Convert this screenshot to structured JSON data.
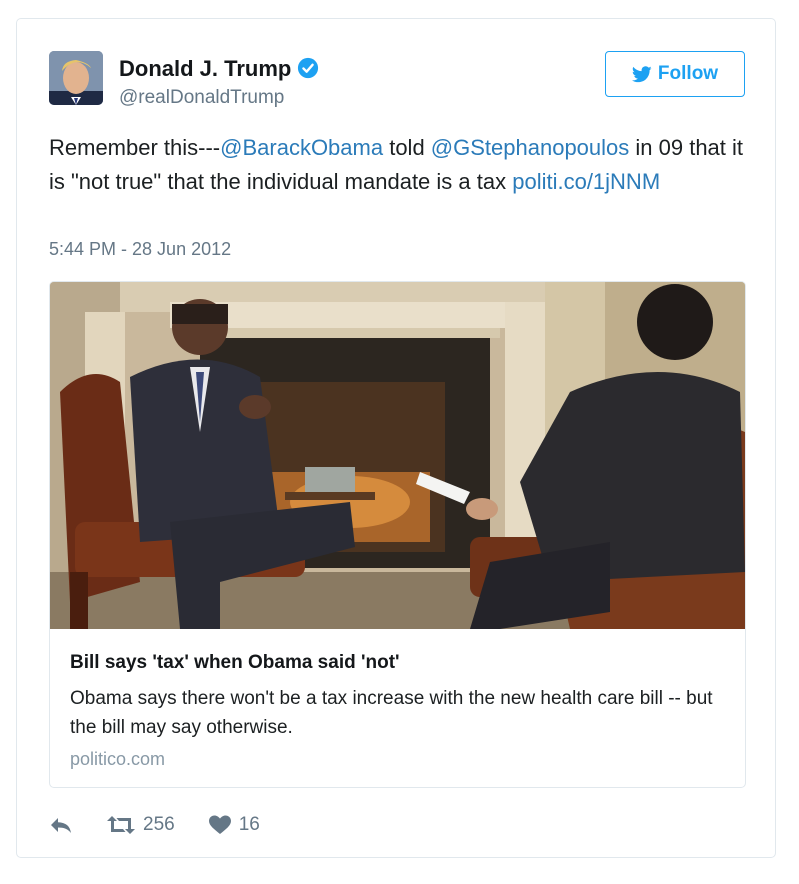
{
  "user": {
    "name": "Donald J. Trump",
    "handle": "@realDonaldTrump",
    "verified": true
  },
  "follow_button": {
    "label": "Follow"
  },
  "tweet": {
    "text_parts": [
      "Remember this---",
      "@BarackObama",
      " told ",
      "@GStephanopoulos",
      " in 09 that it is \"not true\" that the individual mandate is a tax "
    ],
    "link": "politi.co/1jNNM",
    "timestamp": "5:44 PM - 28 Jun 2012"
  },
  "card": {
    "title": "Bill says 'tax' when Obama said 'not'",
    "description": "Obama says there won't be a tax increase with the new health care bill -- but the bill may say otherwise.",
    "domain": "politico.com"
  },
  "actions": {
    "reply_icon": "reply-icon",
    "retweet_icon": "retweet-icon",
    "retweet_count": "256",
    "like_icon": "heart-icon",
    "like_count": "16"
  },
  "colors": {
    "accent": "#1da1f2",
    "link": "#2b7bb9",
    "muted": "#657786",
    "border": "#e1e8ed"
  }
}
